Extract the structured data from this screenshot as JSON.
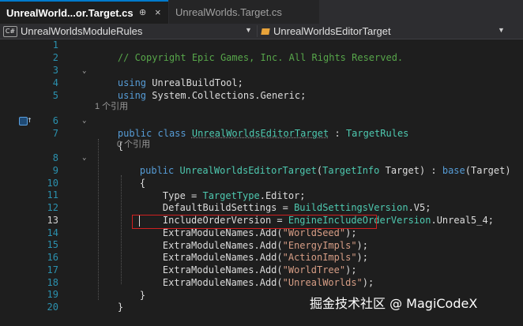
{
  "tabs": [
    {
      "label": "UnrealWorld...or.Target.cs",
      "pin_glyph": "⊕",
      "close_glyph": "×",
      "active": true
    },
    {
      "label": "UnrealWorlds.Target.cs",
      "active": false
    }
  ],
  "navbar": {
    "cs_badge": "C#",
    "left_selector": "UnrealWorldsModuleRules",
    "right_selector": "UnrealWorldsEditorTarget"
  },
  "gutter": {
    "row6_marker_arrow": "↑"
  },
  "editor": {
    "line_numbers": [
      "1",
      "2",
      "3",
      "4",
      "5",
      "6",
      "7",
      "8",
      "9",
      "10",
      "11",
      "12",
      "13",
      "14",
      "15",
      "16",
      "17",
      "18",
      "19",
      "20"
    ],
    "current_line": "13",
    "lines": {
      "l1": {
        "comment": "// Copyright Epic Games, Inc. All Rights Reserved."
      },
      "l3": {
        "kw": "using",
        "rest": " UnrealBuildTool;"
      },
      "l4": {
        "kw": "using",
        "rest": " System.Collections.Generic;"
      },
      "lens1": "1 个引用",
      "l6": {
        "kw1": "public",
        "kw2": "class",
        "cls": "UnrealWorldsEditorTarget",
        "sep": " : ",
        "base": "TargetRules"
      },
      "l7": {
        "brace": "{"
      },
      "lens2": "0 个引用",
      "l8": {
        "kw": "public",
        "name": "UnrealWorldsEditorTarget",
        "open": "(",
        "ptype": "TargetInfo",
        "pname": " Target) : ",
        "base_kw": "base",
        "tail": "(Target)"
      },
      "l9": {
        "brace": "{"
      },
      "l10": {
        "a": "Type = ",
        "t": "TargetType",
        "b": ".Editor;"
      },
      "l11": {
        "a": "DefaultBuildSettings = ",
        "t": "BuildSettingsVersion",
        "b": ".V5;"
      },
      "l12": {
        "a": "IncludeOrderVersion = ",
        "t": "EngineIncludeOrderVersion",
        "b": ".Unreal5_4;"
      },
      "l13": {
        "a": "ExtraModuleNames.Add(",
        "s": "\"WorldSeed\"",
        "b": ");"
      },
      "l14": {
        "a": "ExtraModuleNames.Add(",
        "s": "\"EnergyImpls\"",
        "b": ");"
      },
      "l15": {
        "a": "ExtraModuleNames.Add(",
        "s": "\"ActionImpls\"",
        "b": ");"
      },
      "l16": {
        "a": "ExtraModuleNames.Add(",
        "s": "\"WorldTree\"",
        "b": ");"
      },
      "l17": {
        "a": "ExtraModuleNames.Add(",
        "s": "\"UnrealWorlds\"",
        "b": ");"
      },
      "l18": {
        "brace": "}"
      },
      "l19": {
        "brace": "}"
      }
    }
  },
  "watermark": "掘金技术社区 @ MagiCodeX",
  "colors": {
    "keyword": "#569cd6",
    "type": "#4ec9b0",
    "comment": "#57a64a",
    "string": "#d69d85",
    "line_number": "#2b91af",
    "highlight_box": "#d02020"
  }
}
